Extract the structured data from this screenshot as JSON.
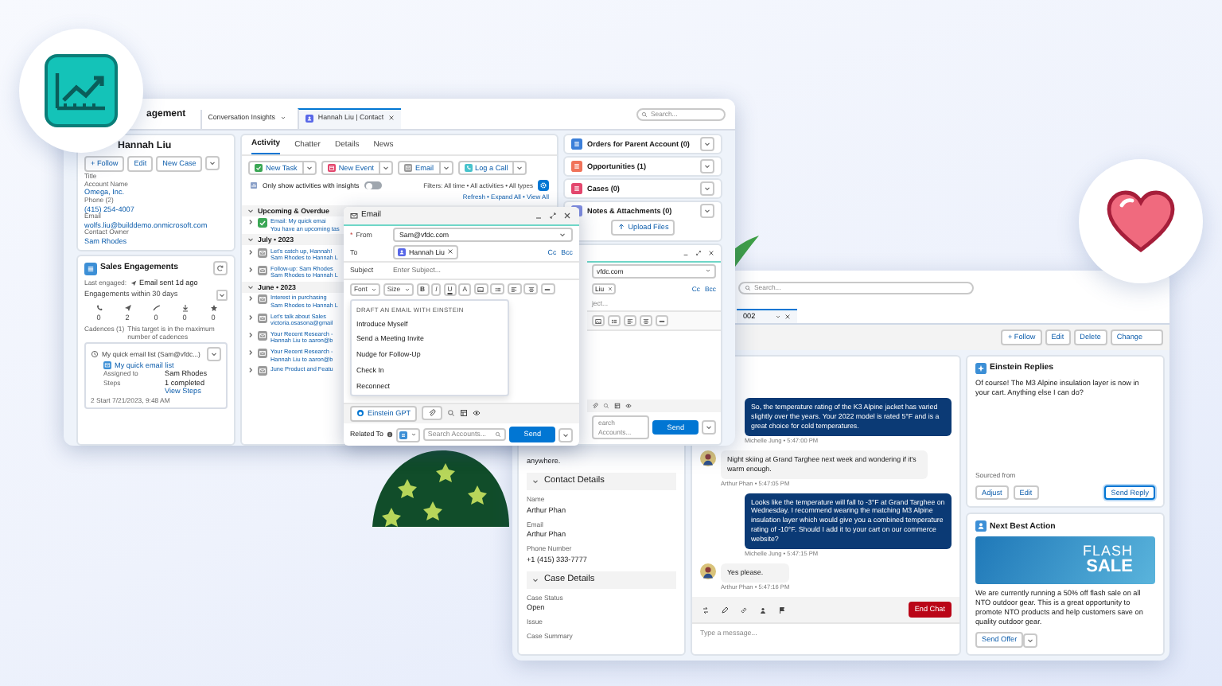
{
  "front_window": {
    "app_name": "agement",
    "nav_tabs": [
      {
        "label": "Conversation Insights",
        "selected": false
      },
      {
        "label": "Hannah Liu | Contact",
        "selected": true
      }
    ],
    "search": {
      "placeholder": "Search..."
    },
    "contact_card": {
      "name": "Hannah Liu",
      "actions": [
        "+ Follow",
        "Edit",
        "New Case"
      ],
      "fields": [
        {
          "label": "Title"
        },
        {
          "label": "Account Name",
          "value": "Omega, Inc."
        },
        {
          "label": "Phone (2)",
          "value": "(415) 254-4007"
        },
        {
          "label": "Email",
          "value": "wolfs.liu@builddemo.onmicrosoft.com"
        },
        {
          "label": "Contact Owner",
          "value": "Sam Rhodes"
        }
      ]
    },
    "sales_engagements": {
      "title": "Sales Engagements",
      "last_engaged_label": "Last engaged:",
      "last_engaged": "Email sent 1d ago",
      "range": "Engagements within 30 days",
      "stats": [
        "0",
        "2",
        "0",
        "0",
        "0"
      ],
      "cadences_label": "Cadences (1)",
      "cadences_note": "This target is in the maximum number of cadences",
      "cadence": {
        "title": "My quick email list (Sam@vfdc...)",
        "link": "My quick email list",
        "assigned_label": "Assigned to",
        "assigned": "Sam Rhodes",
        "steps_label": "Steps",
        "steps": "1 completed",
        "view_steps": "View Steps",
        "started": "2  Start 7/21/2023, 9:48 AM"
      }
    },
    "activity": {
      "tabs": [
        {
          "label": "Activity",
          "selected": true
        },
        {
          "label": "Chatter",
          "selected": false
        },
        {
          "label": "Details",
          "selected": false
        },
        {
          "label": "News",
          "selected": false
        }
      ],
      "actions": [
        {
          "label": "New Task",
          "kind": "task"
        },
        {
          "label": "New Event",
          "kind": "event"
        },
        {
          "label": "Email",
          "kind": "email"
        },
        {
          "label": "Log a Call",
          "kind": "call"
        }
      ],
      "insights_toggle": {
        "label": "Only show activities with insights",
        "on": false
      },
      "filters": "Filters: All time • All activities • All types",
      "links": "Refresh • Expand All • View All",
      "groups": [
        {
          "title": "Upcoming & Overdue",
          "items": [
            {
              "kind": "task",
              "title": "Email: My quick emai",
              "detail": "You have an upcoming tas"
            }
          ]
        },
        {
          "title": "July • 2023",
          "items": [
            {
              "kind": "email",
              "title": "Let's catch up, Hannah!",
              "detail": "Sam Rhodes to Hannah L"
            },
            {
              "kind": "email",
              "title": "Follow-up: Sam Rhodes",
              "detail": "Sam Rhodes to Hannah L"
            }
          ]
        },
        {
          "title": "June • 2023",
          "items": [
            {
              "kind": "email",
              "title": "Interest in purchasing",
              "detail": "Sam Rhodes to Hannah L"
            },
            {
              "kind": "email",
              "title": "Let's talk about Sales",
              "detail": "victoria.osasona@gmail"
            },
            {
              "kind": "email",
              "title": "Your Recent Research -",
              "detail": "Hannah Liu to aaron@b"
            },
            {
              "kind": "email",
              "title": "Your Recent Research -",
              "detail": "Hannah Liu to aaron@b"
            },
            {
              "kind": "email",
              "title": "June Product and Featu"
            }
          ]
        }
      ]
    },
    "related": [
      {
        "title": "Orders for Parent Account (0)",
        "color": "#3b7fd9"
      },
      {
        "title": "Opportunities (1)",
        "color": "#f0735a"
      },
      {
        "title": "Cases (0)",
        "color": "#e3466d"
      },
      {
        "title": "Notes & Attachments (0)",
        "color": "#7f8de1",
        "upload": "Upload Files"
      }
    ],
    "docked_composer": {
      "from": "vfdc.com",
      "to": "Liu",
      "cc": "Cc",
      "bcc": "Bcc",
      "subject_placeholder": "ject...",
      "search": "earch Accounts...",
      "send": "Send"
    }
  },
  "email_composer": {
    "title": "Email",
    "required_mark": "*",
    "from_label": "From",
    "from": "Sam@vfdc.com",
    "to_label": "To",
    "to": "Hannah Liu",
    "cc": "Cc",
    "bcc": "Bcc",
    "subject_label": "Subject",
    "subject_placeholder": "Enter Subject...",
    "font": "Font",
    "size": "Size",
    "format_buttons": [
      "B",
      "I",
      "U",
      "A"
    ],
    "menu": {
      "heading": "DRAFT AN EMAIL WITH EINSTEIN",
      "items": [
        "Introduce Myself",
        "Send a Meeting Invite",
        "Nudge for Follow-Up",
        "Check In",
        "Reconnect"
      ]
    },
    "einstein_button": "Einstein GPT",
    "related_label": "Related To",
    "related_placeholder": "Search Accounts...",
    "send": "Send"
  },
  "back_window": {
    "search": {
      "placeholder": "Search..."
    },
    "tab": "002",
    "record_actions": [
      "+ Follow",
      "Edit",
      "Delete",
      "Change"
    ],
    "intro_tail": "anywhere.",
    "sections": [
      {
        "title": "Contact Details",
        "expanded": true,
        "fields": [
          {
            "label": "Name",
            "value": "Arthur Phan"
          },
          {
            "label": "Email",
            "value": "Arthur Phan"
          },
          {
            "label": "Phone Number",
            "value": "+1 (415) 333-7777"
          }
        ]
      },
      {
        "title": "Case Details",
        "expanded": true,
        "fields": [
          {
            "label": "Case Status",
            "value": "Open"
          },
          {
            "label": "Issue"
          },
          {
            "label": "Case Summary"
          }
        ]
      }
    ],
    "chat": {
      "messages": [
        {
          "kind": "agent",
          "text": "So, the temperature rating of the K3 Alpine jacket has varied slightly over the years. Your 2022 model is rated 5°F and is a great choice for cold temperatures.",
          "meta": "Michelle Jung • 5:47:00 PM"
        },
        {
          "kind": "customer",
          "text": "Night skiing at Grand Targhee next week and wondering if it's warm enough.",
          "meta": "Arthur Phan • 5:47:05 PM"
        },
        {
          "kind": "agent",
          "text": "Looks like the temperature will fall to -3°F at Grand Targhee on Wednesday. I recommend wearing the matching M3 Alpine insulation layer which would give you a combined temperature rating of -10°F. Should I add it to your cart on our commerce website?",
          "meta": "Michelle Jung • 5:47:15 PM"
        },
        {
          "kind": "customer",
          "text": "Yes please.",
          "meta": "Arthur Phan • 5:47:16 PM"
        }
      ],
      "end_chat": "End Chat",
      "input_placeholder": "Type a message..."
    },
    "einstein_replies": {
      "title": "Einstein Replies",
      "reply": "Of course! The M3 Alpine insulation layer is now in your cart. Anything else I can do?",
      "sourced_label": "Sourced from",
      "buttons": [
        {
          "label": "Adjust",
          "selected": false
        },
        {
          "label": "Edit",
          "selected": false
        },
        {
          "label": "Send Reply",
          "selected": true
        }
      ]
    },
    "next_best_action": {
      "title": "Next Best Action",
      "banner": [
        "FLASH",
        "SALE"
      ],
      "body": "We are currently running a 50% off flash sale on all NTO outdoor gear. This is a great opportunity to promote NTO products and help customers save on quality outdoor gear.",
      "button": "Send Offer"
    }
  }
}
